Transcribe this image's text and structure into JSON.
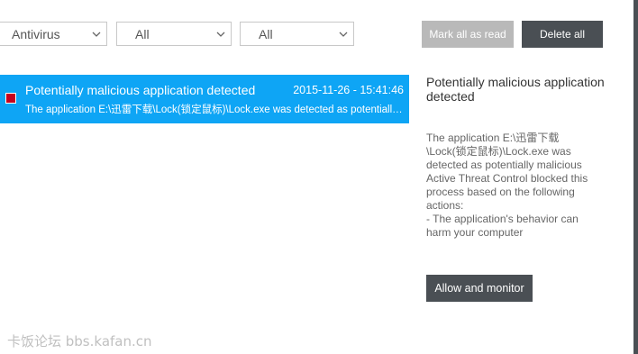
{
  "filters": {
    "type": {
      "value": "Antivirus",
      "icon": "chevron-down-icon"
    },
    "severity": {
      "value": "All",
      "icon": "chevron-down-icon"
    },
    "status": {
      "value": "All",
      "icon": "chevron-down-icon"
    }
  },
  "toolbar": {
    "mark_all_read": "Mark all as read",
    "delete_all": "Delete all"
  },
  "notifications": [
    {
      "title": "Potentially malicious application detected",
      "timestamp": "2015-11-26 - 15:41:46",
      "description": "The application E:\\迅雷下载\\Lock(锁定鼠标)\\Lock.exe was detected as potentially malicious",
      "flag_color": "#c6001e",
      "selected": true
    }
  ],
  "detail": {
    "title": "Potentially malicious application detected",
    "lines": [
      "The application E:\\迅雷下载\\Lock(锁定鼠标)\\Lock.exe was detected as potentially malicious",
      "Active Threat Control blocked this process based on the following actions:",
      "- The application's behavior can harm your computer"
    ],
    "action_button": "Allow and monitor"
  },
  "watermark": "卡饭论坛 bbs.kafan.cn",
  "colors": {
    "selected_row": "#0ea5f5",
    "dark_button": "#4a4f54",
    "disabled_button": "#b9b9b9",
    "flag": "#c6001e"
  }
}
